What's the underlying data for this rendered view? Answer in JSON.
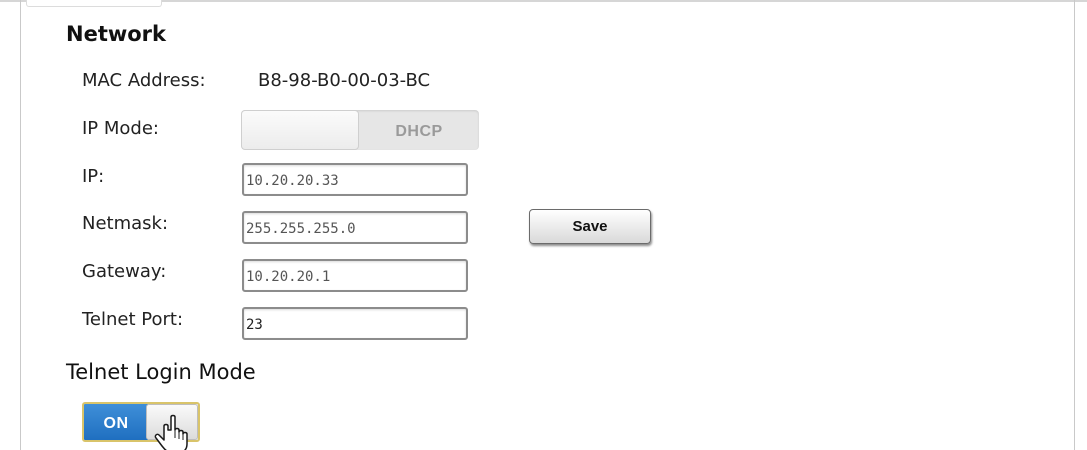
{
  "network": {
    "title": "Network",
    "mac_label": "MAC Address:",
    "mac_value": "B8-98-B0-00-03-BC",
    "ip_mode_label": "IP Mode:",
    "ip_mode_value": "DHCP",
    "ip_label": "IP:",
    "ip_value": "10.20.20.33",
    "netmask_label": "Netmask:",
    "netmask_value": "255.255.255.0",
    "gateway_label": "Gateway:",
    "gateway_value": "10.20.20.1",
    "telnet_port_label": "Telnet Port:",
    "telnet_port_value": "23",
    "save_label": "Save"
  },
  "telnet_login": {
    "title": "Telnet Login Mode",
    "toggle_state": "ON"
  },
  "icons": {
    "cursor": "hand-pointer-icon"
  },
  "colors": {
    "toggle_on": "#2a7fcf",
    "toggle_focus_border": "#d9c46a",
    "disabled_text": "#9a9a9a"
  }
}
